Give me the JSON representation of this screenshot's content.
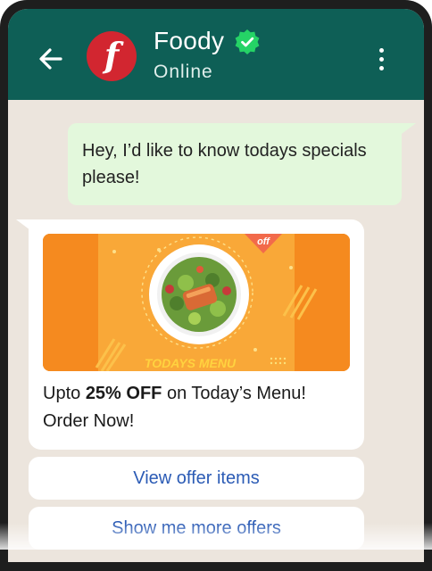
{
  "header": {
    "back_icon": "arrow-left-icon",
    "avatar_letter": "f",
    "contact_name": "Foody",
    "verified_icon": "verified-badge-icon",
    "status": "Online",
    "menu_icon": "more-vertical-icon"
  },
  "colors": {
    "header_bg": "#0e5f56",
    "chat_bg": "#ece5dd",
    "outgoing_bubble": "#e3f8dc",
    "incoming_bubble": "#ffffff",
    "avatar_bg": "#d22630",
    "verified_badge": "#25d366",
    "link_text": "#2b5bb5",
    "banner_orange": "#f7992d"
  },
  "messages": {
    "outgoing_text": "Hey, I’d like to know todays specials please!",
    "incoming": {
      "banner_badge": "off",
      "banner_title": "TODAYS MENU",
      "caption_prefix": "Upto ",
      "caption_bold": "25% OFF",
      "caption_suffix": " on Today’s Menu!",
      "caption_line2": "Order Now!"
    }
  },
  "quick_replies": [
    {
      "label": "View offer items"
    },
    {
      "label": "Show me more offers"
    }
  ]
}
